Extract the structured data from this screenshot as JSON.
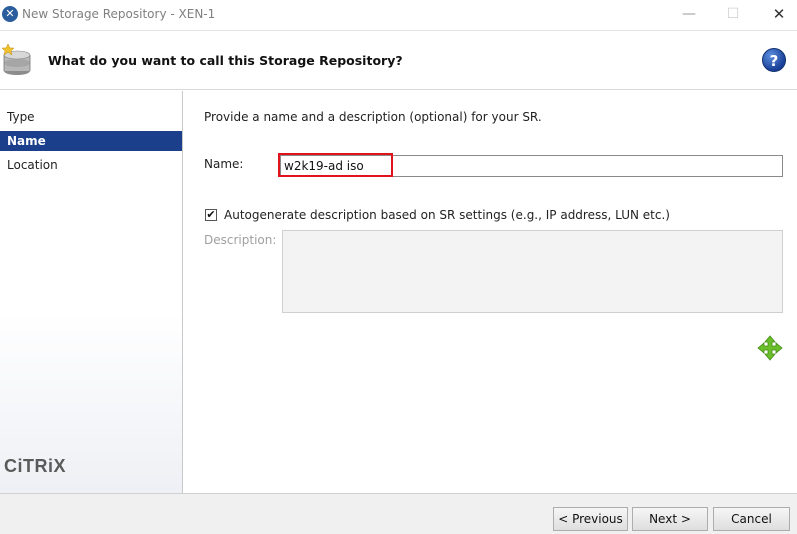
{
  "window": {
    "title": "New Storage Repository - XEN-1",
    "app_icon_glyph": "✕",
    "minimize_glyph": "—",
    "maximize_glyph": "☐",
    "close_glyph": "✕"
  },
  "header": {
    "title": "What do you want to call this Storage Repository?",
    "help_glyph": "?"
  },
  "sidebar": {
    "items": [
      {
        "label": "Type",
        "active": false
      },
      {
        "label": "Name",
        "active": true
      },
      {
        "label": "Location",
        "active": false
      }
    ],
    "logo_text": "CiTRiX"
  },
  "form": {
    "intro": "Provide a name and a description (optional) for your SR.",
    "name_label": "Name:",
    "name_value": "w2k19-ad iso",
    "auto_checkbox_checked": true,
    "auto_checkbox_glyph": "✔",
    "auto_label": "Autogenerate description based on SR settings (e.g., IP address, LUN etc.)",
    "description_label": "Description:",
    "description_value": ""
  },
  "footer": {
    "previous_label": "< Previous",
    "next_label": "Next >",
    "cancel_label": "Cancel"
  },
  "colors": {
    "accent": "#1b3f8b",
    "highlight": "#e0121c",
    "move_icon": "#6abf2a"
  }
}
